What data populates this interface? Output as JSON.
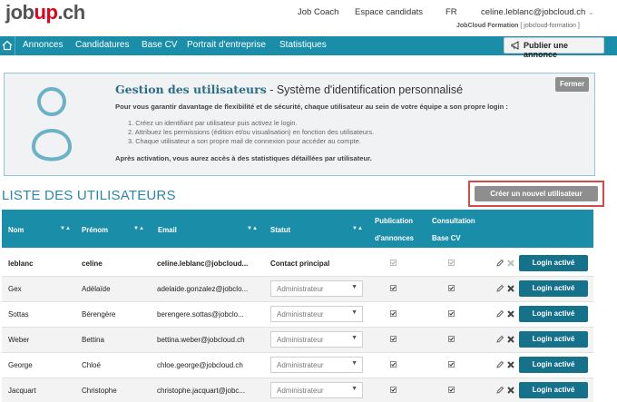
{
  "header": {
    "logo_prefix": "job",
    "logo_up": "up",
    "logo_suffix": ".ch",
    "job_coach": "Job Coach",
    "candidates_space": "Espace candidats",
    "language": "FR",
    "user_email": "celine.leblanc@jobcloud.ch",
    "user_caret": "⌄",
    "company_name": "JobCloud Formation",
    "company_id": "[ jobcloud-formation ]"
  },
  "nav": {
    "home_icon": "home-icon",
    "items": [
      "Annonces",
      "Candidatures",
      "Base CV",
      "Portrait d'entreprise",
      "Statistiques"
    ],
    "publish_label": "Publier une annonce"
  },
  "info": {
    "title_bold": "Gestion des utilisateurs",
    "title_rest": " - Système d'identification personnalisé",
    "lead": "Pour vous garantir davantage de flexibilité et de sécurité, chaque utilisateur au sein de votre équipe a son propre login :",
    "steps": [
      "1. Créez un identifiant par utilisateur puis activez le login.",
      "2. Attribuez les permissions (édition et/ou visualisation) en fonction des utilisateurs.",
      "3. Chaque utilisateur a son propre mail de connexion pour accéder au compte."
    ],
    "after": "Après activation, vous aurez accès à des statistiques détaillées par utilisateur.",
    "close_label": "Fermer"
  },
  "list": {
    "title": "LISTE DES UTILISATEURS",
    "create_label": "Créer un nouvel utilisateur"
  },
  "table": {
    "headers": {
      "nom": "Nom",
      "prenom": "Prénom",
      "email": "Email",
      "statut": "Statut",
      "publication_1": "Publication",
      "publication_2": "d'annonces",
      "consultation_1": "Consultation",
      "consultation_2": "Base CV"
    },
    "rows": [
      {
        "nom": "leblanc",
        "prenom": "celine",
        "email": "celine.leblanc@jobcloud...",
        "statut": "Contact principal",
        "login": "Login activé"
      },
      {
        "nom": "Gex",
        "prenom": "Adélaïde",
        "email": "adelaide.gonzalez@jobclo...",
        "statut": "Administrateur",
        "login": "Login activé"
      },
      {
        "nom": "Sottas",
        "prenom": "Bérengère",
        "email": "berengere.sottas@jobclo...",
        "statut": "Administrateur",
        "login": "Login activé"
      },
      {
        "nom": "Weber",
        "prenom": "Bettina",
        "email": "bettina.weber@jobcloud.ch",
        "statut": "Administrateur",
        "login": "Login activé"
      },
      {
        "nom": "George",
        "prenom": "Chloé",
        "email": "chloe.george@jobcloud.ch",
        "statut": "Administrateur",
        "login": "Login activé"
      },
      {
        "nom": "Jacquart",
        "prenom": "Christophe",
        "email": "christophe.jacquart@jobc...",
        "statut": "Administrateur",
        "login": "Login activé"
      }
    ]
  },
  "colors": {
    "nav_bg": "#1a8ea9",
    "title_blue": "#2b87a5",
    "login_btn": "#16728a",
    "logo_red": "#e2001a",
    "highlight_red": "#d24b49"
  }
}
